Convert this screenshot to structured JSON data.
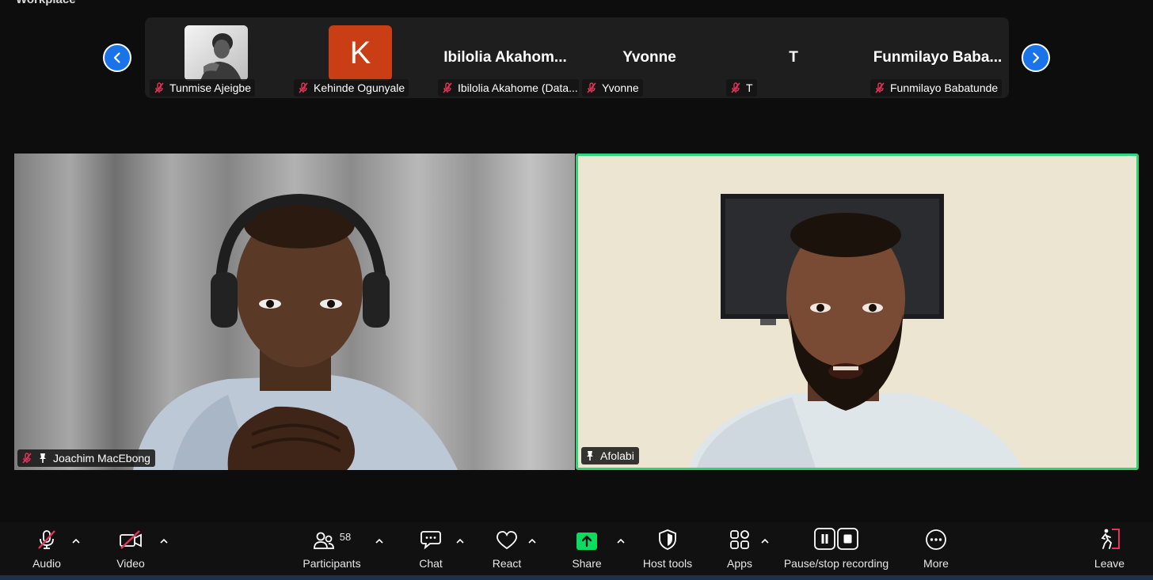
{
  "window": {
    "title": "Workplace"
  },
  "strip": {
    "participants": [
      {
        "name": "Tunmise Ajeigbe",
        "type": "photo",
        "muted": true
      },
      {
        "name": "Kehinde Ogunyale",
        "type": "initial",
        "initial": "K",
        "color": "#c93e14",
        "muted": true
      },
      {
        "name": "Ibilolia Akahome (Data...",
        "type": "text",
        "display": "Ibilolia  Akahom...",
        "muted": true
      },
      {
        "name": "Yvonne",
        "type": "text",
        "display": "Yvonne",
        "muted": true
      },
      {
        "name": "T",
        "type": "text",
        "display": "T",
        "muted": true
      },
      {
        "name": "Funmilayo Babatunde",
        "type": "text",
        "display": "Funmilayo  Baba...",
        "muted": true
      }
    ]
  },
  "videos": {
    "left": {
      "name": "Joachim MacEbong",
      "muted": true,
      "pinned": true
    },
    "right": {
      "name": "Afolabi",
      "muted": false,
      "pinned": true,
      "active_speaker": true,
      "active_color": "#2ed47a"
    }
  },
  "toolbar": {
    "audio": "Audio",
    "video": "Video",
    "participants": "Participants",
    "participants_count": "58",
    "chat": "Chat",
    "react": "React",
    "share": "Share",
    "host_tools": "Host tools",
    "apps": "Apps",
    "recording": "Pause/stop recording",
    "more": "More",
    "leave": "Leave"
  },
  "colors": {
    "accent": "#1a73e8",
    "share": "#0bdc5f",
    "leave": "#e8325a",
    "muted_icon": "#e8325a"
  }
}
